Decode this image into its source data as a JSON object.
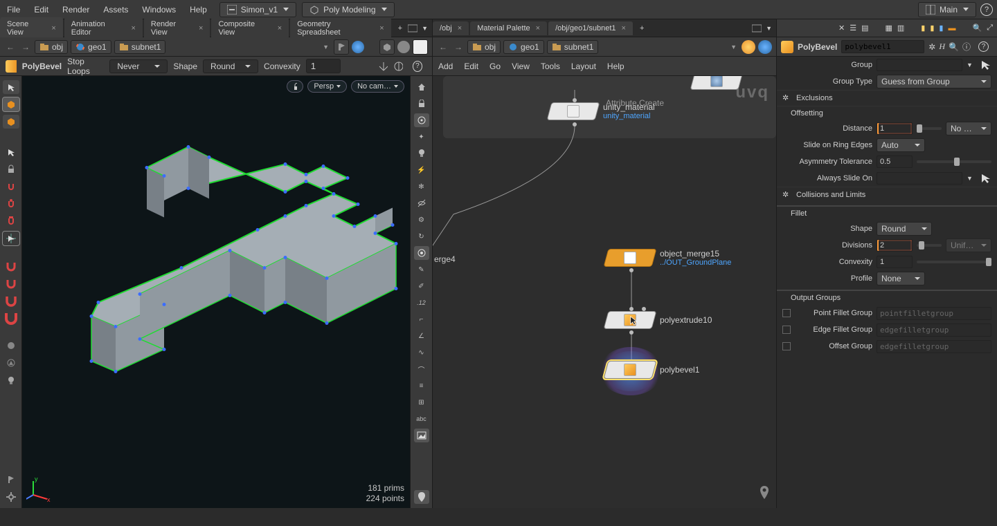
{
  "menus": {
    "file": "File",
    "edit": "Edit",
    "render": "Render",
    "assets": "Assets",
    "windows": "Windows",
    "help": "Help"
  },
  "shelves": {
    "scene": "Simon_v1",
    "task": "Poly Modeling",
    "desktop": "Main"
  },
  "left_tabs": [
    {
      "label": "Scene View",
      "active": true
    },
    {
      "label": "Animation Editor",
      "active": false
    },
    {
      "label": "Render View",
      "active": false
    },
    {
      "label": "Composite View",
      "active": false
    },
    {
      "label": "Geometry Spreadsheet",
      "active": false
    }
  ],
  "right_tabs": [
    {
      "label": "/obj",
      "active": false
    },
    {
      "label": "Material Palette",
      "active": false
    },
    {
      "label": "/obj/geo1/subnet1",
      "active": true
    }
  ],
  "path_left": [
    "obj",
    "geo1",
    "subnet1"
  ],
  "path_right": [
    "obj",
    "geo1",
    "subnet1"
  ],
  "opbar": {
    "opname": "PolyBevel",
    "stop_loops": "Stop Loops",
    "stop_loops_val": "Never",
    "shape": "Shape",
    "shape_val": "Round",
    "convexity": "Convexity",
    "convexity_val": "1"
  },
  "viewport": {
    "cam_pill": "Persp",
    "nocam": "No cam…",
    "prims": "181  prims",
    "points": "224 points"
  },
  "network": {
    "menus": {
      "add": "Add",
      "edit": "Edit",
      "go": "Go",
      "view": "View",
      "tools": "Tools",
      "layout": "Layout",
      "help": "Help"
    },
    "ghost": "uvq",
    "erge": "erge4",
    "ghost_header": "Attribute Create",
    "nodes": {
      "unity": "unity_material",
      "unity_sub": "unity_material",
      "merge": "object_merge15",
      "merge_sub": "../OUT_GroundPlane",
      "extrude": "polyextrude10",
      "bevel": "polybevel1"
    }
  },
  "params": {
    "op_type": "PolyBevel",
    "op_name": "polybevel1",
    "group": "Group",
    "group_type": "Group Type",
    "group_type_val": "Guess from Group",
    "excl": "Exclusions",
    "offsetting": "Offsetting",
    "distance": "Distance",
    "distance_val": "1",
    "distance_sel": "No Sca…",
    "slide": "Slide on Ring Edges",
    "slide_val": "Auto",
    "asym": "Asymmetry Tolerance",
    "asym_val": "0.5",
    "always": "Always Slide On",
    "collisions": "Collisions and Limits",
    "fillet": "Fillet",
    "shape": "Shape",
    "shape_val": "Round",
    "divisions": "Divisions",
    "divisions_val": "2",
    "divisions_sel": "Unifor…",
    "convexity": "Convexity",
    "convexity_val": "1",
    "profile": "Profile",
    "profile_val": "None",
    "output_groups": "Output Groups",
    "pfg": "Point Fillet Group",
    "pfg_val": "pointfilletgroup",
    "efg": "Edge Fillet Group",
    "efg_val": "edgefilletgroup",
    "og": "Offset Group",
    "og_val": "edgefilletgroup"
  }
}
